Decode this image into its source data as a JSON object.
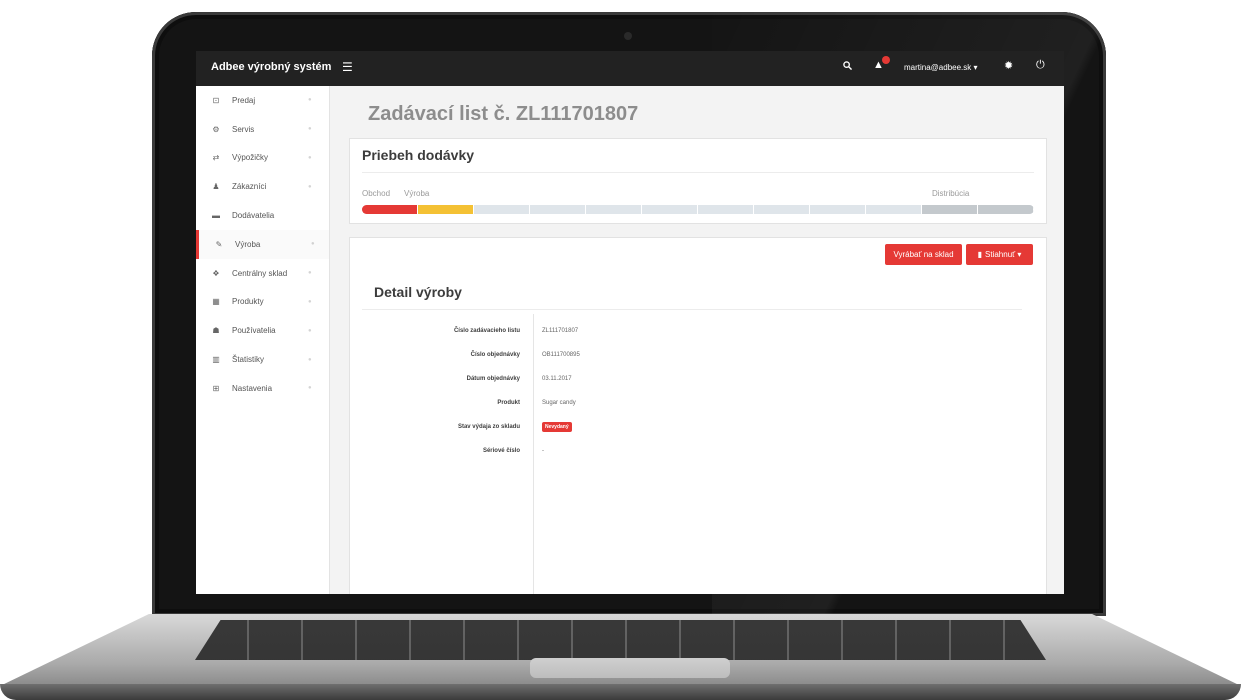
{
  "app": {
    "brand": "Adbee výrobný systém",
    "user_email": "martina@adbee.sk ▾"
  },
  "colors": {
    "accent": "#e53935",
    "warning": "#f4c134",
    "topbar": "#222222"
  },
  "sidebar": {
    "items": [
      {
        "label": "Predaj",
        "icon": "cash-icon",
        "glyph": "⊡",
        "active": false,
        "chevron": true
      },
      {
        "label": "Servis",
        "icon": "cogs-icon",
        "glyph": "⚙",
        "active": false,
        "chevron": true
      },
      {
        "label": "Výpožičky",
        "icon": "exchange-icon",
        "glyph": "⇄",
        "active": false,
        "chevron": true
      },
      {
        "label": "Zákazníci",
        "icon": "person-icon",
        "glyph": "♟",
        "active": false,
        "chevron": true
      },
      {
        "label": "Dodávatelia",
        "icon": "truck-icon",
        "glyph": "▬",
        "active": false,
        "chevron": false
      },
      {
        "label": "Výroba",
        "icon": "wrench-icon",
        "glyph": "✎",
        "active": true,
        "chevron": true
      },
      {
        "label": "Centrálny sklad",
        "icon": "cubes-icon",
        "glyph": "❖",
        "active": false,
        "chevron": true
      },
      {
        "label": "Produkty",
        "icon": "grid-icon",
        "glyph": "▦",
        "active": false,
        "chevron": true
      },
      {
        "label": "Používatelia",
        "icon": "users-icon",
        "glyph": "☗",
        "active": false,
        "chevron": true
      },
      {
        "label": "Štatistiky",
        "icon": "bar-chart-icon",
        "glyph": "▥",
        "active": false,
        "chevron": true
      },
      {
        "label": "Nastavenia",
        "icon": "plus-square-icon",
        "glyph": "⊞",
        "active": false,
        "chevron": true
      }
    ]
  },
  "page": {
    "title": "Zadávací list č. ZL111701807"
  },
  "delivery": {
    "title": "Priebeh dodávky",
    "stages": {
      "order": "Obchod",
      "production": "Výroba",
      "distribution": "Distribúcia"
    },
    "progress": [
      "done",
      "current",
      "pending",
      "pending",
      "pending",
      "pending",
      "pending",
      "pending",
      "pending",
      "pending",
      "final",
      "final"
    ]
  },
  "detail": {
    "title": "Detail výroby",
    "btn_produce": "Vyrábať na sklad",
    "btn_download": "Stiahnuť ▾",
    "rows": [
      {
        "label": "Číslo zadávacieho listu",
        "value": "ZL111701807"
      },
      {
        "label": "Číslo objednávky",
        "value": "OB111700895"
      },
      {
        "label": "Dátum objednávky",
        "value": "03.11.2017"
      },
      {
        "label": "Produkt",
        "value": "Sugar candy"
      },
      {
        "label": "Stav výdaja zo skladu",
        "value": "Nevydaný"
      },
      {
        "label": "Sériové číslo",
        "value": "-"
      }
    ]
  }
}
